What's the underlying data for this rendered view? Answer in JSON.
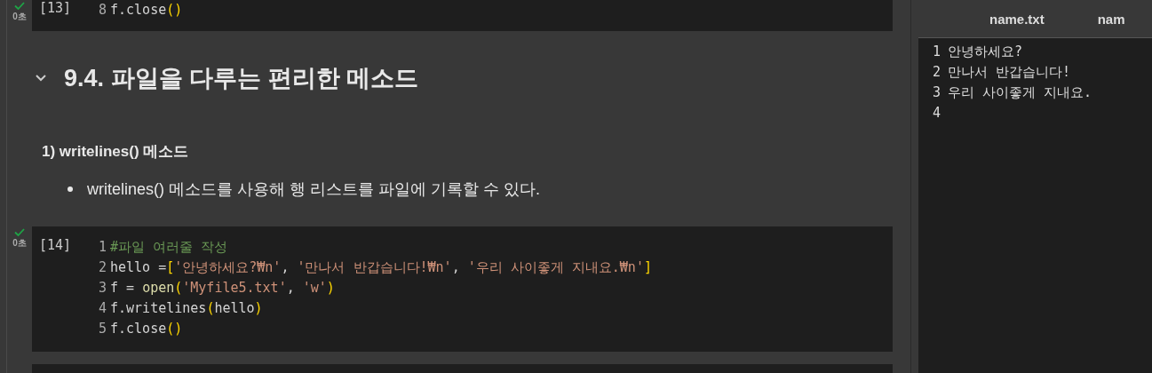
{
  "cells": [
    {
      "kind": "code",
      "status": "0초",
      "count": "[13]",
      "lines": [
        {
          "number": "8",
          "tokens": [
            {
              "kind": "plain",
              "text": "f.close"
            },
            {
              "kind": "paren",
              "text": "()"
            }
          ]
        }
      ]
    },
    {
      "kind": "heading",
      "text": "9.4. 파일을 다루는 편리한 메소드"
    },
    {
      "kind": "subheading",
      "text": "1) writelines() 메소드"
    },
    {
      "kind": "bullet",
      "text": "writelines() 메소드를 사용해 행 리스트를 파일에 기록할 수 있다."
    },
    {
      "kind": "code",
      "status": "0초",
      "count": "[14]",
      "lines": [
        {
          "number": "1",
          "tokens": [
            {
              "kind": "comment",
              "text": "#파일 여러줄 작성"
            }
          ]
        },
        {
          "number": "2",
          "tokens": [
            {
              "kind": "plain",
              "text": "hello ="
            },
            {
              "kind": "paren",
              "text": "["
            },
            {
              "kind": "string",
              "text": "'안녕하세요?₩n'"
            },
            {
              "kind": "plain",
              "text": ", "
            },
            {
              "kind": "string",
              "text": "'만나서 반갑습니다!₩n'"
            },
            {
              "kind": "plain",
              "text": ", "
            },
            {
              "kind": "string",
              "text": "'우리 사이좋게 지내요.₩n'"
            },
            {
              "kind": "paren",
              "text": "]"
            }
          ]
        },
        {
          "number": "3",
          "tokens": [
            {
              "kind": "plain",
              "text": "f = "
            },
            {
              "kind": "func",
              "text": "open"
            },
            {
              "kind": "paren",
              "text": "("
            },
            {
              "kind": "string",
              "text": "'Myfile5.txt'"
            },
            {
              "kind": "plain",
              "text": ", "
            },
            {
              "kind": "string",
              "text": "'w'"
            },
            {
              "kind": "paren",
              "text": ")"
            }
          ]
        },
        {
          "number": "4",
          "tokens": [
            {
              "kind": "plain",
              "text": "f.writelines"
            },
            {
              "kind": "paren",
              "text": "("
            },
            {
              "kind": "plain",
              "text": "hello"
            },
            {
              "kind": "paren",
              "text": ")"
            }
          ]
        },
        {
          "number": "5",
          "tokens": [
            {
              "kind": "plain",
              "text": "f.close"
            },
            {
              "kind": "paren",
              "text": "()"
            }
          ]
        }
      ]
    },
    {
      "kind": "empty_code"
    }
  ],
  "file_viewer": {
    "tabs": [
      "name.txt",
      "nam"
    ],
    "lines": [
      {
        "number": "1",
        "text": "안녕하세요?"
      },
      {
        "number": "2",
        "text": "만나서 반갑습니다!"
      },
      {
        "number": "3",
        "text": "우리 사이좋게 지내요."
      },
      {
        "number": "4"
      }
    ]
  }
}
